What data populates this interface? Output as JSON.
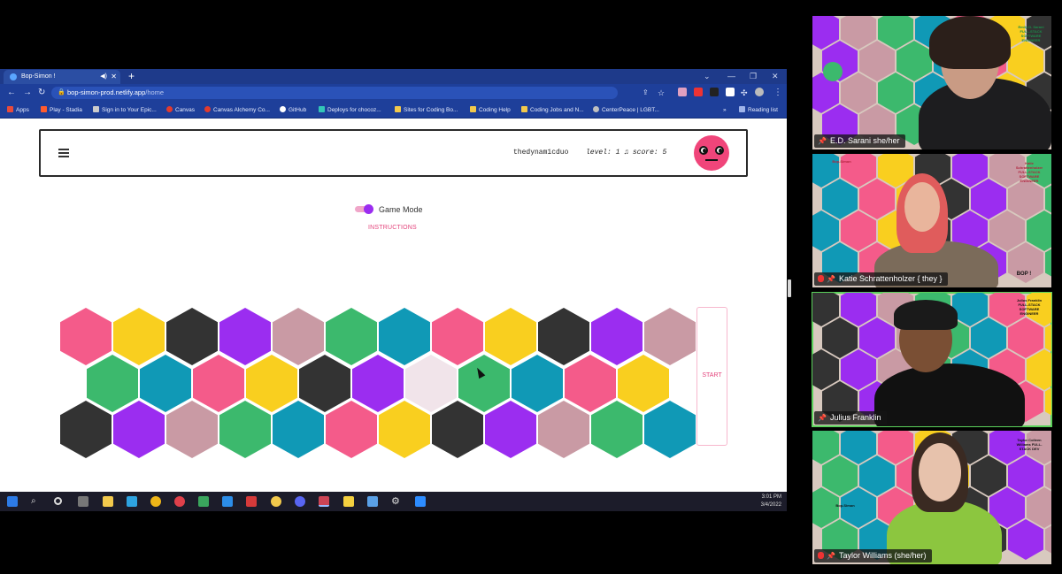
{
  "browser": {
    "tab_title": "Bop-Simon !",
    "url_host": "bop-simon-prod.netlify.app",
    "url_path": "/home",
    "bookmarks": [
      {
        "label": "Apps",
        "color": "#e84b3c"
      },
      {
        "label": "Play - Stadia",
        "color": "#ff5b2e"
      },
      {
        "label": "Sign in to Your Epic...",
        "color": "#cccccc"
      },
      {
        "label": "Canvas",
        "color": "#e23b2e"
      },
      {
        "label": "Canvas Alchemy Co...",
        "color": "#e23b2e"
      },
      {
        "label": "GitHub",
        "color": "#ffffff"
      },
      {
        "label": "Deploys for chocoz...",
        "color": "#32c7b7"
      },
      {
        "label": "Sites for Coding Bo...",
        "color": "#f2c94c"
      },
      {
        "label": "Coding Help",
        "color": "#f2c94c"
      },
      {
        "label": "Coding Jobs and N...",
        "color": "#f2c94c"
      },
      {
        "label": "CenterPeace | LGBT...",
        "color": "#c0c0c0"
      }
    ],
    "reading_list": "Reading list",
    "more_bookmarks": "»"
  },
  "app": {
    "username": "thedynam1cduo",
    "level_label": "level:",
    "level": "1",
    "score_label": "score:",
    "score": "5",
    "game_mode_label": "Game Mode",
    "instructions_label": "INSTRUCTIONS",
    "start_label": "START"
  },
  "board": {
    "colors": {
      "pink": "#f45b8a",
      "yellow": "#f9cf1f",
      "black": "#333333",
      "purple": "#9b2df0",
      "rose": "#c99aa4",
      "green": "#3cb96d",
      "teal": "#1099b6",
      "blush": "#f1e4ea"
    },
    "rows": [
      [
        "pink",
        "yellow",
        "black",
        "purple",
        "rose",
        "green",
        "teal",
        "pink",
        "yellow",
        "black",
        "purple",
        "rose"
      ],
      [
        "green",
        "teal",
        "pink",
        "yellow",
        "black",
        "purple",
        "blush",
        "green",
        "teal",
        "pink",
        "yellow"
      ],
      [
        "black",
        "purple",
        "rose",
        "green",
        "teal",
        "pink",
        "yellow",
        "black",
        "purple",
        "rose",
        "green",
        "teal"
      ]
    ]
  },
  "taskbar": {
    "time": "3:01 PM",
    "date": "3/4/2022"
  },
  "participants": [
    {
      "name": "E.D. Sarani she/her",
      "muted": false,
      "active": false
    },
    {
      "name": "Katie Schrattenholzer { they }",
      "muted": true,
      "active": false
    },
    {
      "name": "Julius Franklin",
      "muted": false,
      "active": true
    },
    {
      "name": "Taylor Williams (she/her)",
      "muted": true,
      "active": false
    }
  ],
  "tile_badges": {
    "sarani": "Emily D. Sarani FULL-STACK SOFTWARE ENGINEER",
    "katie": "Katie Schrattenholzer FULL-STACK SOFTWARE ENGINEER",
    "julius": "Julius Franklin FULL-STACK SOFTWARE ENGINEER",
    "taylor": "Taylor Colleen Williams FULL-STACK DEV",
    "bop_simon": "Bop-Simon",
    "bop": "BOP !"
  }
}
